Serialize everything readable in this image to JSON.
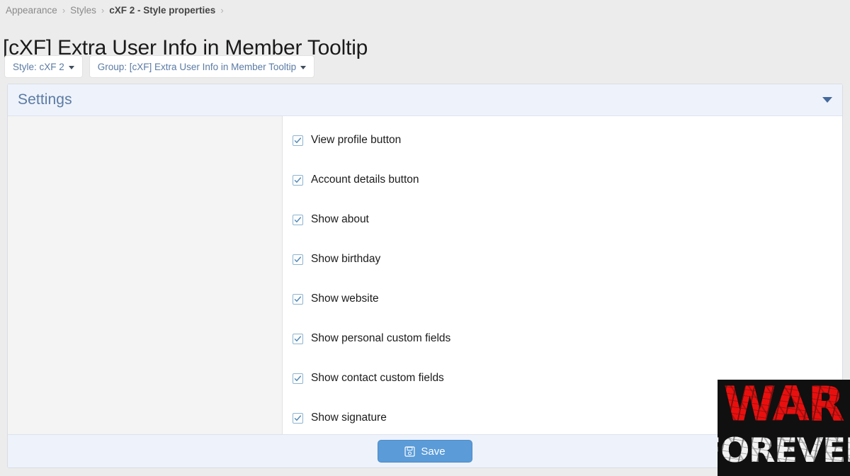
{
  "breadcrumb": {
    "separator": "›",
    "items": [
      {
        "label": "Appearance",
        "current": false
      },
      {
        "label": "Styles",
        "current": false
      },
      {
        "label": "cXF 2 - Style properties",
        "current": true
      }
    ]
  },
  "page_title": "[cXF] Extra User Info in Member Tooltip",
  "filters": [
    {
      "name": "style-filter",
      "label": "Style: cXF 2"
    },
    {
      "name": "group-filter",
      "label": "Group: [cXF] Extra User Info in Member Tooltip"
    }
  ],
  "panel": {
    "header_title": "Settings",
    "collapse_icon": "chevron-down-icon"
  },
  "options": [
    {
      "label": "View profile button",
      "checked": true
    },
    {
      "label": "Account details button",
      "checked": true
    },
    {
      "label": "Show about",
      "checked": true
    },
    {
      "label": "Show birthday",
      "checked": true
    },
    {
      "label": "Show website",
      "checked": true
    },
    {
      "label": "Show personal custom fields",
      "checked": true
    },
    {
      "label": "Show contact custom fields",
      "checked": true
    },
    {
      "label": "Show signature",
      "checked": true
    }
  ],
  "footer": {
    "save_label": "Save",
    "save_icon": "floppy-disk-icon"
  },
  "watermark": {
    "line1": "WAR",
    "line2": "FOREVER"
  },
  "colors": {
    "accent_blue": "#5b7ba5",
    "save_button": "#5a9bd8",
    "header_bg": "#eef2fa",
    "page_bg": "#ececec",
    "watermark_red": "#e8100f",
    "watermark_bg": "#101010"
  }
}
